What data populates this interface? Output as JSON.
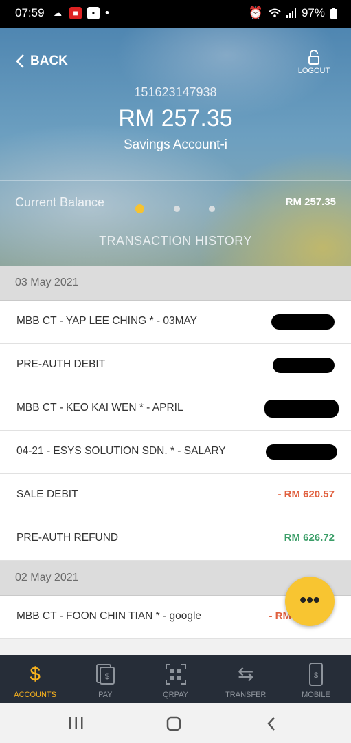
{
  "status_bar": {
    "time": "07:59",
    "battery": "97%"
  },
  "header": {
    "back_label": "BACK",
    "logout_label": "LOGOUT",
    "account_number": "151623147938",
    "balance": "RM 257.35",
    "account_type": "Savings Account-i",
    "current_balance_label": "Current Balance",
    "current_balance_value": "RM 257.35",
    "section_title": "TRANSACTION HISTORY"
  },
  "groups": [
    {
      "date": "03 May 2021",
      "transactions": [
        {
          "description": "MBB CT - YAP LEE CHING * - 03MAY",
          "amount": ""
        },
        {
          "description": "PRE-AUTH DEBIT",
          "amount": ""
        },
        {
          "description": "MBB CT - KEO KAI WEN * - APRIL",
          "amount": ""
        },
        {
          "description": "04-21 - ESYS SOLUTION SDN. * - SALARY",
          "amount": ""
        },
        {
          "description": "SALE DEBIT",
          "amount": "- RM 620.57"
        },
        {
          "description": "PRE-AUTH REFUND",
          "amount": "RM 626.72"
        }
      ]
    },
    {
      "date": "02 May 2021",
      "transactions": [
        {
          "description": "MBB CT - FOON CHIN TIAN * - google",
          "amount": "- RM"
        }
      ]
    }
  ],
  "fab": {
    "label": "•••"
  },
  "tabs": [
    {
      "label": "ACCOUNTS",
      "icon": "dollar-icon",
      "active": true
    },
    {
      "label": "PAY",
      "icon": "bill-icon",
      "active": false
    },
    {
      "label": "QRPAY",
      "icon": "qr-icon",
      "active": false
    },
    {
      "label": "TRANSFER",
      "icon": "transfer-icon",
      "active": false
    },
    {
      "label": "MOBILE",
      "icon": "mobile-icon",
      "active": false
    }
  ],
  "colors": {
    "accent": "#f8b21e",
    "negative": "#e0603f",
    "positive": "#3b9e68",
    "tabbar": "#262d38"
  }
}
